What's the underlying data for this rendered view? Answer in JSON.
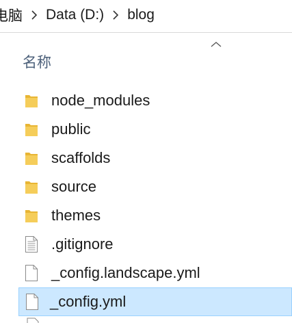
{
  "breadcrumb": {
    "items": [
      "电脑",
      "Data (D:)",
      "blog"
    ]
  },
  "column_header": {
    "name_label": "名称",
    "sort_icon": "chevron-up-icon"
  },
  "files": [
    {
      "name": "node_modules",
      "type": "folder",
      "icon": "folder-icon"
    },
    {
      "name": "public",
      "type": "folder",
      "icon": "folder-icon"
    },
    {
      "name": "scaffolds",
      "type": "folder",
      "icon": "folder-icon"
    },
    {
      "name": "source",
      "type": "folder",
      "icon": "folder-icon"
    },
    {
      "name": "themes",
      "type": "folder",
      "icon": "folder-icon"
    },
    {
      "name": ".gitignore",
      "type": "text-file",
      "icon": "text-file-icon"
    },
    {
      "name": "_config.landscape.yml",
      "type": "file",
      "icon": "file-icon"
    },
    {
      "name": "_config.yml",
      "type": "file",
      "icon": "file-icon",
      "selected": true
    }
  ],
  "colors": {
    "folder": "#f0c243",
    "selection_bg": "#cce8ff",
    "selection_border": "#99d1ff",
    "header_text": "#4c607a"
  }
}
